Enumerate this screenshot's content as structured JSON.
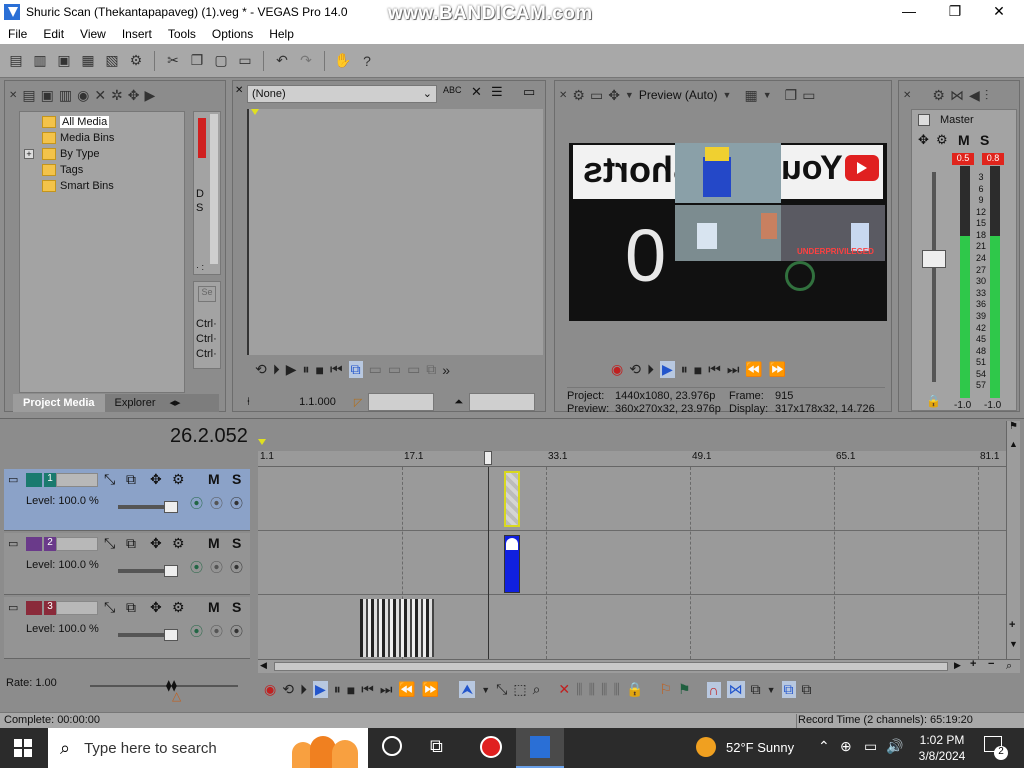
{
  "window": {
    "title": "Shuric Scan (Thekantapapaveg) (1).veg * - VEGAS Pro 14.0",
    "watermark": "www.BANDICAM.com",
    "minimize": "—",
    "maximize": "❐",
    "close": "✕"
  },
  "menu": [
    "File",
    "Edit",
    "View",
    "Insert",
    "Tools",
    "Options",
    "Help"
  ],
  "media_panel": {
    "tree": [
      "All Media",
      "Media Bins",
      "By Type",
      "Tags",
      "Smart Bins"
    ],
    "expander": "+",
    "tabs": [
      "Project Media",
      "Explorer"
    ],
    "side_letters": [
      "D",
      "S"
    ],
    "ctrl_labels": [
      "Ctrl·",
      "Ctrl·",
      "Ctrl·"
    ],
    "side_dots": "· :"
  },
  "trimmer": {
    "dropdown": "(None)",
    "timecode": "1.1.000"
  },
  "preview": {
    "mode": "Preview (Auto)",
    "project_label": "Project:",
    "project_value": "1440x1080, 23.976p",
    "preview_label": "Preview:",
    "preview_value": "360x270x32, 23.976p",
    "frame_label": "Frame:",
    "frame_value": "915",
    "display_label": "Display:",
    "display_value": "317x178x32, 14.726",
    "thumb_text_shorts": "Shorts",
    "thumb_text_you": "You",
    "thumb_text_zero": "0",
    "thumb_caption": "UNDERPRIVILEGED"
  },
  "mixer": {
    "title": "Master",
    "mute": "M",
    "solo": "S",
    "peak_left": "0.5",
    "peak_right": "0.8",
    "scale": [
      "3",
      "6",
      "9",
      "12",
      "15",
      "18",
      "21",
      "24",
      "27",
      "30",
      "33",
      "36",
      "39",
      "42",
      "45",
      "48",
      "51",
      "54",
      "57"
    ],
    "level_left": "-1.0",
    "level_right": "-1.0",
    "lock_icon": "🔒"
  },
  "timeline": {
    "cursor_time": "26.2.052",
    "ruler": [
      "1.1",
      "17.1",
      "33.1",
      "49.1",
      "65.1",
      "81.1"
    ],
    "tracks": [
      {
        "number": "1",
        "level": "Level: 100.0 %",
        "color": "#1a7a6e"
      },
      {
        "number": "2",
        "level": "Level: 100.0 %",
        "color": "#6a3a8a"
      },
      {
        "number": "3",
        "level": "Level: 100.0 %",
        "color": "#8a2a3a"
      }
    ],
    "mute": "M",
    "solo": "S",
    "rate": "Rate: 1.00"
  },
  "status": {
    "complete": "Complete: 00:00:00",
    "record_time": "Record Time (2 channels): 65:19:20"
  },
  "taskbar": {
    "search_placeholder": "Type here to search",
    "weather": "52°F  Sunny",
    "time": "1:02 PM",
    "date": "3/8/2024",
    "notifications": "2"
  },
  "colors": {
    "accent": "#2a6fd6",
    "meter_green": "#2fc84a",
    "peak_red": "#e0241c",
    "selected_track": "#8ba2c8",
    "event_blue": "#1020e0"
  }
}
